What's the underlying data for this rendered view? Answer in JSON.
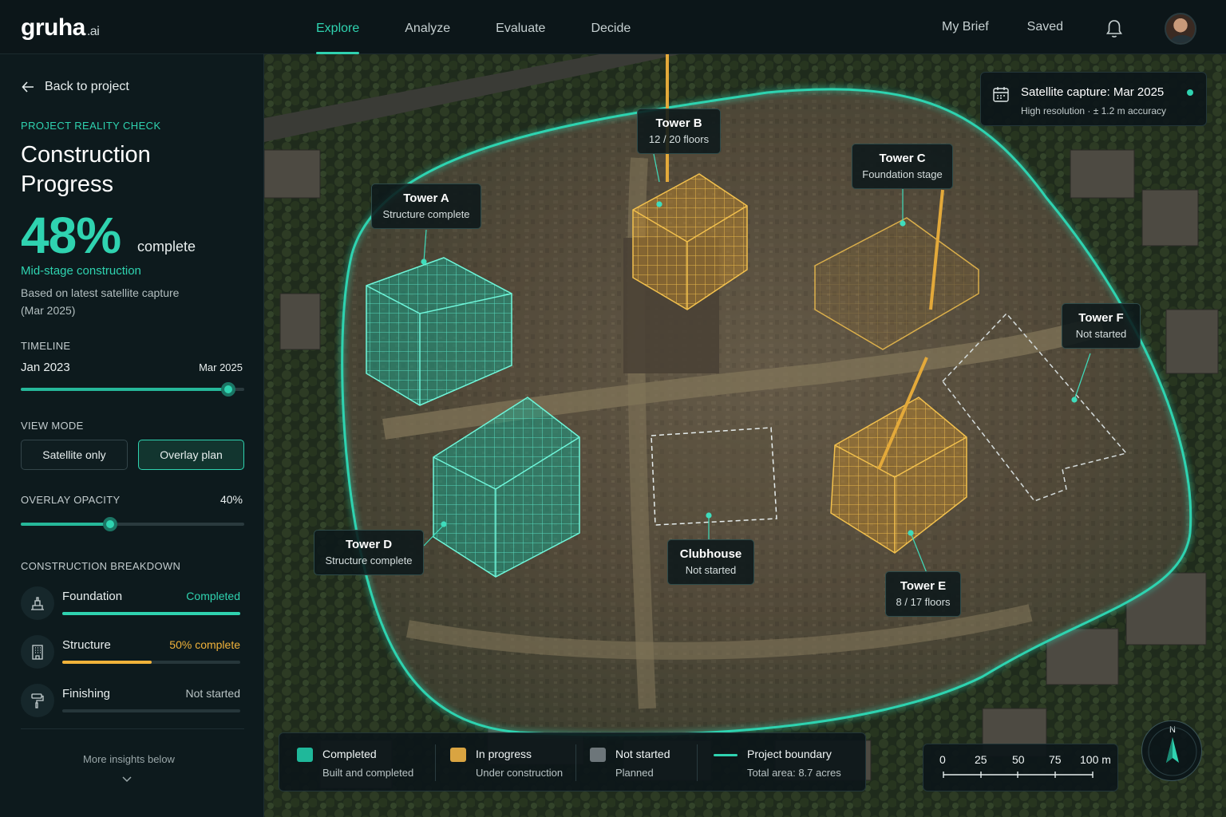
{
  "app": {
    "logo_main": "gruha",
    "logo_suffix": ".ai"
  },
  "nav": {
    "tabs": [
      {
        "label": "Explore",
        "active": true
      },
      {
        "label": "Analyze",
        "active": false
      },
      {
        "label": "Evaluate",
        "active": false
      },
      {
        "label": "Decide",
        "active": false
      }
    ],
    "my_brief": "My Brief",
    "saved": "Saved",
    "bell_icon": "bell-icon",
    "avatar_icon": "user-avatar"
  },
  "sidebar": {
    "back_label": "Back to project",
    "eyebrow": "PROJECT REALITY CHECK",
    "title": "Construction Progress",
    "percent": "48%",
    "percent_suffix": "complete",
    "percent_value": 0.48,
    "stage": "Mid-stage construction",
    "basis": "Based on latest satellite capture (Mar 2025)",
    "timeline": {
      "label": "TIMELINE",
      "start": "Jan 2023",
      "end": "Mar 2025",
      "position": 0.93
    },
    "view_mode": {
      "label": "VIEW MODE",
      "options": [
        "Satellite only",
        "Overlay plan"
      ],
      "selected": "Overlay plan"
    },
    "overlay_opacity": {
      "label": "OVERLAY OPACITY",
      "value_text": "40%",
      "value": 0.4
    },
    "breakdown": {
      "label": "CONSTRUCTION BREAKDOWN",
      "items": [
        {
          "name": "Foundation",
          "status": "Completed",
          "progress": 1.0,
          "color": "#2fd3b0",
          "icon": "foundation-icon"
        },
        {
          "name": "Structure",
          "status": "50% complete",
          "progress": 0.5,
          "color": "#f0b23a",
          "icon": "building-icon"
        },
        {
          "name": "Finishing",
          "status": "Not started",
          "progress": 0.0,
          "color": "#9aa7a9",
          "icon": "paint-roller-icon"
        }
      ]
    },
    "more_insights": "More insights below"
  },
  "map": {
    "satellite_card": {
      "title": "Satellite capture: Mar 2025",
      "subtitle": "High resolution · ± 1.2 m accuracy"
    },
    "callouts": [
      {
        "name": "Tower A",
        "status": "Structure complete",
        "state": "completed"
      },
      {
        "name": "Tower B",
        "status": "12 / 20 floors",
        "state": "in-progress"
      },
      {
        "name": "Tower C",
        "status": "Foundation stage",
        "state": "in-progress"
      },
      {
        "name": "Tower D",
        "status": "Structure complete",
        "state": "completed"
      },
      {
        "name": "Tower E",
        "status": "8 / 17 floors",
        "state": "in-progress"
      },
      {
        "name": "Tower F",
        "status": "Not started",
        "state": "not-started"
      },
      {
        "name": "Clubhouse",
        "status": "Not started",
        "state": "not-started"
      }
    ],
    "legend": [
      {
        "title": "Completed",
        "sub": "Built and completed",
        "color": "#1fb89a"
      },
      {
        "title": "In progress",
        "sub": "Under construction",
        "color": "#d9a441"
      },
      {
        "title": "Not started",
        "sub": "Planned",
        "color": "#6d767a"
      },
      {
        "title": "Project boundary",
        "sub": "Total area: 8.7 acres",
        "color": "#2fd3b0"
      }
    ],
    "scale": {
      "ticks": [
        "0",
        "25",
        "50",
        "75",
        "100 m"
      ]
    },
    "compass": {
      "north": "N"
    }
  },
  "colors": {
    "accent": "#2fd3b0",
    "in_progress": "#f0b23a",
    "not_started": "#9aa7a9"
  }
}
